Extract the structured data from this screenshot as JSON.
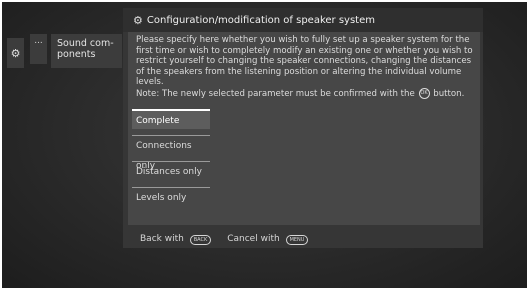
{
  "breadcrumb": {
    "settings_icon": "gear-icon",
    "more_label": "...",
    "sound_label": "Sound com-\nponents"
  },
  "dialog": {
    "title_icon": "speaker-settings-icon",
    "title": "Configuration/modification of speaker system",
    "description_main": "Please specify here whether you wish to fully set up a speaker system for the first time or wish to completely modify an existing one or whether you wish to restrict yourself to changing the speaker connections, changing the distances of the speakers from the listening position or altering the individual volume levels.",
    "note_prefix": "Note: The newly selected parameter must be confirmed with the",
    "note_suffix": "button.",
    "ok_icon_label": "OK",
    "options": [
      {
        "label": "Complete",
        "selected": true
      },
      {
        "label": "Connections only",
        "selected": false
      },
      {
        "label": "Distances only",
        "selected": false
      },
      {
        "label": "Levels only",
        "selected": false
      }
    ]
  },
  "footer": {
    "back_label": "Back with",
    "back_key": "BACK",
    "cancel_label": "Cancel with",
    "cancel_key": "MENU"
  },
  "colors": {
    "background": "#2a2a2a",
    "panel": "#474747",
    "selected": "#5d5d5d"
  }
}
